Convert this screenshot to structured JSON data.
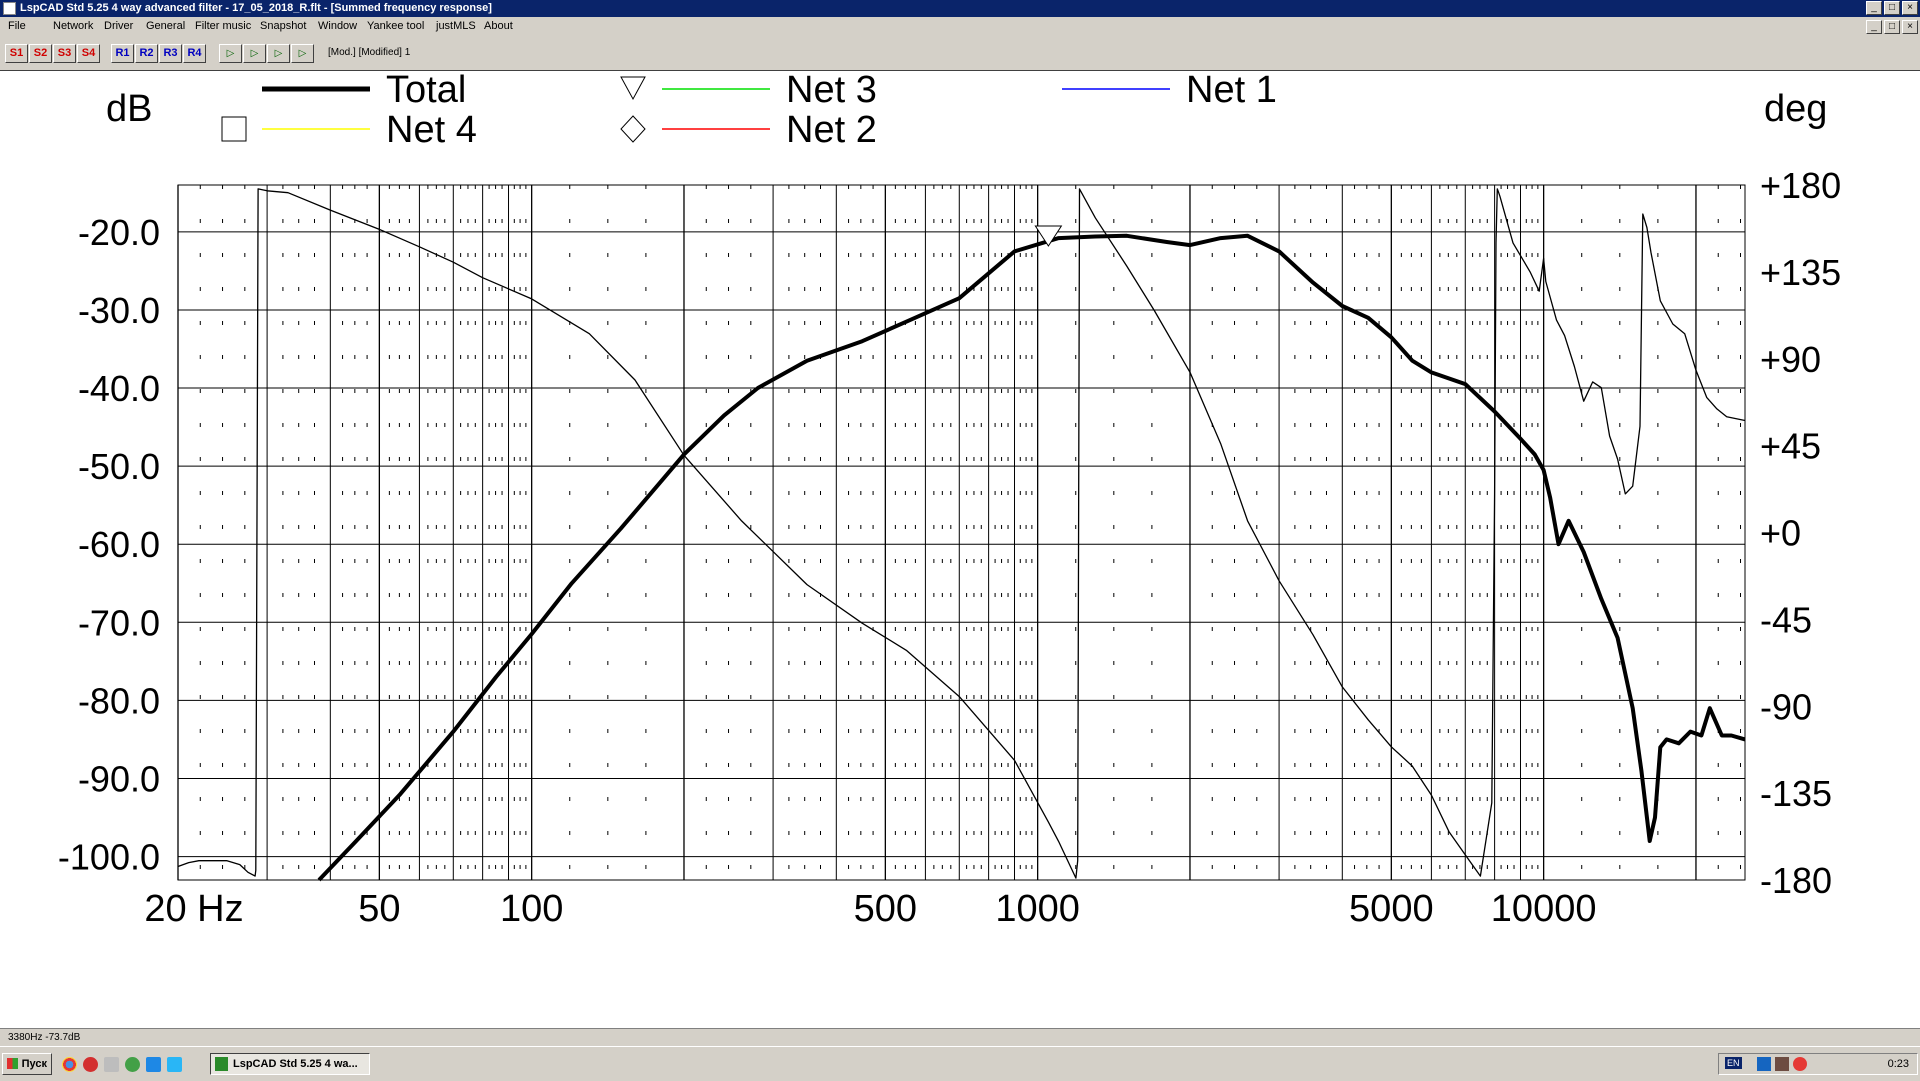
{
  "window": {
    "title": "LspCAD Std 5.25 4 way advanced filter - 17_05_2018_R.flt - [Summed frequency response]",
    "controls": [
      "_",
      "□",
      "×"
    ]
  },
  "menu": {
    "items": [
      "File",
      "Network",
      "Driver",
      "General",
      "Filter music",
      "Snapshot",
      "Window",
      "Yankee tool",
      "justMLS",
      "About"
    ]
  },
  "toolbar": {
    "buttons": [
      "S1",
      "S2",
      "S3",
      "S4",
      "R1",
      "R2",
      "R3",
      "R4"
    ],
    "icon_buttons": [
      "▷",
      "▷",
      "▷",
      "▷"
    ],
    "status": "[Mod.] [Modified] 1"
  },
  "chart_data": {
    "type": "line",
    "xscale": "log",
    "xlim": [
      20,
      25000
    ],
    "ylim": [
      -103,
      -14
    ],
    "y2lim": [
      -180,
      180
    ],
    "ylabel": "dB",
    "y2label": "deg",
    "yticks": [
      "-20.0",
      "-30.0",
      "-40.0",
      "-50.0",
      "-60.0",
      "-70.0",
      "-80.0",
      "-90.0",
      "-100.0"
    ],
    "y2ticks": [
      "+180",
      "+135",
      "+90",
      "+45",
      "+0",
      "-45",
      "-90",
      "-135",
      "-180"
    ],
    "xticks": [
      "20 Hz",
      "50",
      "100",
      "500",
      "1000",
      "5000",
      "10000"
    ],
    "legend": [
      {
        "name": "Total",
        "color": "#000000"
      },
      {
        "name": "Net 4",
        "color": "#ffff00"
      },
      {
        "name": "Net 3",
        "color": "#00e000"
      },
      {
        "name": "Net 2",
        "color": "#ff0000"
      },
      {
        "name": "Net 1",
        "color": "#0000ff"
      }
    ],
    "grid": true,
    "series": [
      {
        "name": "Total",
        "axis": "dB",
        "x": [
          38,
          45,
          55,
          70,
          85,
          100,
          120,
          150,
          180,
          200,
          240,
          280,
          350,
          450,
          550,
          700,
          900,
          1100,
          1300,
          1500,
          1800,
          2000,
          2300,
          2600,
          3000,
          3500,
          4000,
          4500,
          5000,
          5500,
          6000,
          7000,
          8000,
          9000,
          9600,
          10000,
          10300,
          10700,
          11200,
          12000,
          13000,
          14000,
          15000,
          15600,
          16200,
          16600,
          17000,
          17500,
          18500,
          19500,
          20500,
          21300,
          22500,
          23500,
          25000
        ],
        "y": [
          -103,
          -98,
          -92,
          -84,
          -77,
          -71.5,
          -65,
          -58,
          -52,
          -48.5,
          -43.5,
          -40,
          -36.5,
          -34,
          -31.5,
          -28.5,
          -22.5,
          -20.8,
          -20.6,
          -20.5,
          -21.3,
          -21.7,
          -20.8,
          -20.5,
          -22.5,
          -26.5,
          -29.5,
          -31,
          -33.5,
          -36.5,
          -38,
          -39.5,
          -43,
          -46.5,
          -48.5,
          -50.5,
          -54,
          -60,
          -57,
          -61,
          -67,
          -72,
          -81,
          -89,
          -98,
          -95,
          -86,
          -85,
          -85.5,
          -84,
          -84.5,
          -81,
          -84.5,
          -84.5,
          -85
        ]
      },
      {
        "name": "Phase",
        "axis": "deg",
        "x": [
          20,
          21,
          22,
          24,
          25,
          26.5,
          27.5,
          28.4,
          28.5,
          28.8,
          30,
          33,
          40,
          50,
          60,
          70,
          80,
          100,
          130,
          160,
          200,
          260,
          350,
          450,
          550,
          700,
          900,
          1050,
          1100,
          1190,
          1200,
          1210,
          1300,
          1500,
          1700,
          2000,
          2300,
          2600,
          3000,
          3500,
          4000,
          4500,
          5000,
          5500,
          6000,
          6500,
          7000,
          7500,
          7900,
          8000,
          8050,
          8100,
          8150,
          8200,
          8700,
          9400,
          9800,
          10000,
          10100,
          10600,
          11000,
          11500,
          12000,
          12500,
          13000,
          13500,
          14000,
          14500,
          15000,
          15500,
          15700,
          16000,
          16300,
          17000,
          18000,
          19000,
          20000,
          21000,
          22000,
          23000,
          25000
        ],
        "y": [
          -173,
          -171,
          -170,
          -170,
          -170,
          -172,
          -176,
          -178,
          -175,
          178,
          177,
          176,
          167,
          157,
          148,
          140,
          132,
          121,
          103,
          79,
          40,
          6,
          -27,
          -47,
          -61,
          -85,
          -118,
          -150,
          -160,
          -179,
          -170,
          178,
          163,
          138,
          115,
          83,
          46,
          6,
          -25,
          -53,
          -80,
          -97,
          -111,
          -121,
          -136,
          -155,
          -167,
          -178,
          -140,
          20,
          150,
          178,
          176,
          174,
          150,
          135,
          125,
          142,
          130,
          110,
          102,
          86,
          68,
          78,
          75,
          50,
          38,
          20,
          24,
          55,
          165,
          158,
          145,
          120,
          108,
          103,
          84,
          70,
          64,
          60,
          58
        ]
      }
    ]
  },
  "statusbar": {
    "text": "3380Hz  -73.7dB"
  },
  "taskbar": {
    "start_label": "Пуск",
    "task_label": "LspCAD Std 5.25 4 wa...",
    "lang": "EN",
    "clock": "0:23"
  }
}
